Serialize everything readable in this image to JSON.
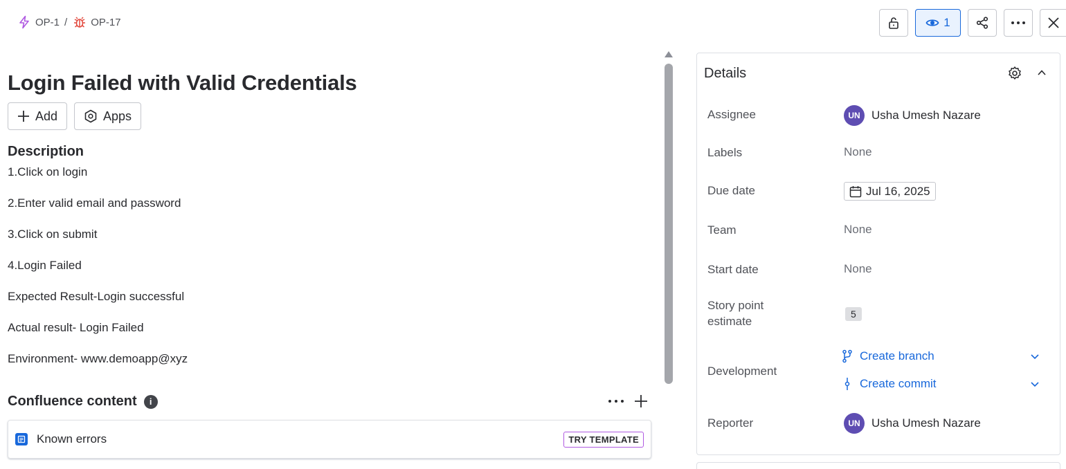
{
  "breadcrumb": [
    {
      "key": "OP-1",
      "icon": "lightning-icon",
      "color": "#af59e1"
    },
    {
      "key": "OP-17",
      "icon": "bug-icon",
      "color": "#e2483d"
    }
  ],
  "breadcrumb_separator": "/",
  "actions": {
    "watch_count": "1"
  },
  "issue": {
    "title": "Login Failed with Valid Credentials",
    "add_label": "Add",
    "apps_label": "Apps"
  },
  "description": {
    "heading": "Description",
    "lines": [
      "1.Click on login",
      "2.Enter valid email and password",
      "3.Click on submit",
      "4.Login Failed",
      "Expected Result-Login successful",
      "Actual result- Login Failed",
      "Environment- www.demoapp@xyz"
    ]
  },
  "confluence": {
    "heading": "Confluence content",
    "info_glyph": "i",
    "card_label": "Known errors",
    "badge": "TRY TEMPLATE"
  },
  "details": {
    "heading": "Details",
    "assignee_label": "Assignee",
    "assignee_initials": "UN",
    "assignee_name": "Usha Umesh Nazare",
    "labels_label": "Labels",
    "labels_value": "None",
    "due_label": "Due date",
    "due_value": "Jul 16, 2025",
    "team_label": "Team",
    "team_value": "None",
    "start_label": "Start date",
    "start_value": "None",
    "sp_label_1": "Story point",
    "sp_label_2": "estimate",
    "sp_value": "5",
    "dev_label": "Development",
    "create_branch": "Create branch",
    "create_commit": "Create commit",
    "reporter_label": "Reporter",
    "reporter_initials": "UN",
    "reporter_name": "Usha Umesh Nazare"
  },
  "colors": {
    "link": "#1868db",
    "avatar": "#5e4db2",
    "badge_border": "#af59e1"
  }
}
